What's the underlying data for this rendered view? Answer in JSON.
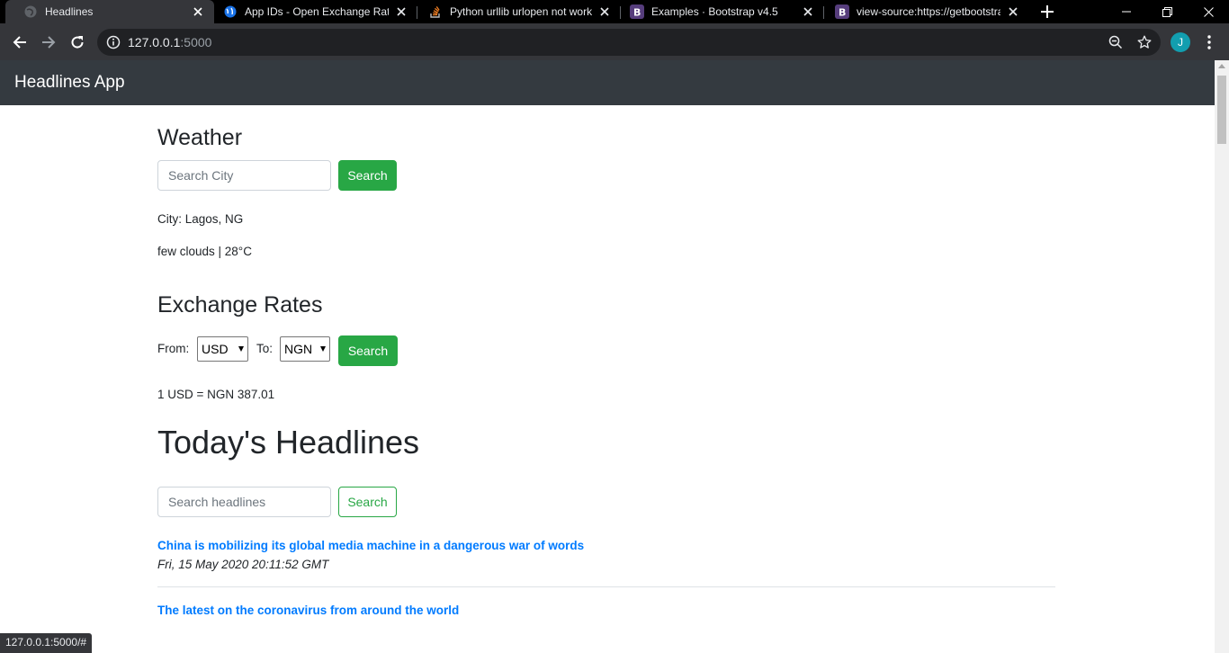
{
  "browser": {
    "tabs": [
      {
        "title": "Headlines",
        "active": true
      },
      {
        "title": "App IDs - Open Exchange Rates",
        "active": false
      },
      {
        "title": "Python urllib urlopen not working",
        "active": false
      },
      {
        "title": "Examples · Bootstrap v4.5",
        "active": false
      },
      {
        "title": "view-source:https://getbootstrap.com",
        "active": false
      }
    ],
    "url_host": "127.0.0.1",
    "url_port": ":5000",
    "profile_initial": "J",
    "status_url": "127.0.0.1:5000/#"
  },
  "navbar": {
    "brand": "Headlines App"
  },
  "weather": {
    "heading": "Weather",
    "search_placeholder": "Search City",
    "search_button": "Search",
    "city_line": "City: Lagos, NG",
    "conditions_line": "few clouds | 28°C"
  },
  "exchange": {
    "heading": "Exchange Rates",
    "from_label": "From:",
    "from_value": "USD",
    "to_label": "To:",
    "to_value": "NGN",
    "search_button": "Search",
    "result": "1 USD = NGN 387.01"
  },
  "headlines": {
    "heading": "Today's Headlines",
    "search_placeholder": "Search headlines",
    "search_button": "Search",
    "articles": [
      {
        "title": "China is mobilizing its global media machine in a dangerous war of words",
        "date": "Fri, 15 May 2020 20:11:52 GMT"
      },
      {
        "title": "The latest on the coronavirus from around the world",
        "date": ""
      }
    ]
  },
  "colors": {
    "primary_link": "#007bff",
    "success": "#28a745",
    "navbar_bg": "#343a40"
  }
}
